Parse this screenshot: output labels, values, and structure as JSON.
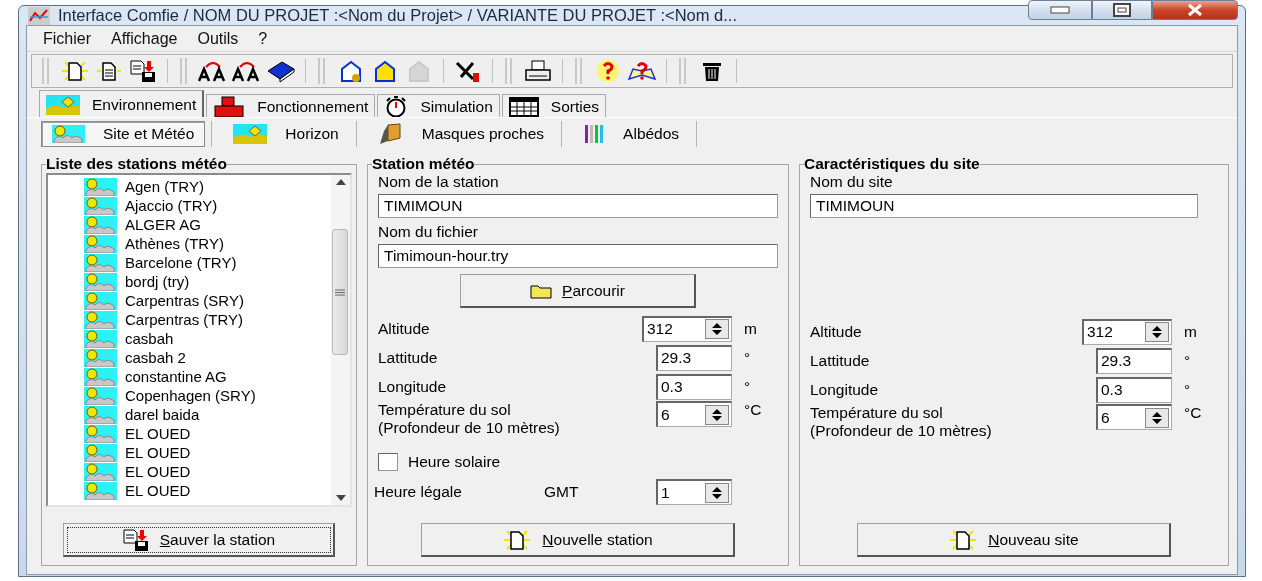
{
  "window": {
    "title": "Interface Comfie  /  NOM DU PROJET :<Nom du Projet>  /  VARIANTE DU PROJET :<Nom d..."
  },
  "menu": [
    "Fichier",
    "Affichage",
    "Outils",
    "?"
  ],
  "toolbar": [
    [
      {
        "disabled": false
      },
      {
        "disabled": false
      },
      {
        "disabled": false
      }
    ],
    [
      {
        "disabled": false
      },
      {
        "disabled": false
      },
      {
        "disabled": false
      }
    ],
    [
      {
        "disabled": false
      },
      {
        "disabled": false
      },
      {
        "disabled": true
      },
      {
        "disabled": false
      }
    ],
    [
      {
        "disabled": false
      }
    ],
    [
      {
        "disabled": false
      },
      {
        "disabled": false
      }
    ],
    [
      {
        "disabled": false
      }
    ]
  ],
  "tabs": [
    {
      "label": "Environnement",
      "selected": true
    },
    {
      "label": "Fonctionnement",
      "selected": false
    },
    {
      "label": "Simulation",
      "selected": false
    },
    {
      "label": "Sorties",
      "selected": false
    }
  ],
  "subtabs": [
    {
      "label": "Site et Météo",
      "selected": true
    },
    {
      "label": "Horizon",
      "selected": false
    },
    {
      "label": "Masques proches",
      "selected": false
    },
    {
      "label": "Albédos",
      "selected": false
    }
  ],
  "stations": {
    "title": "Liste des stations météo",
    "items": [
      "Agen (TRY)",
      "Ajaccio (TRY)",
      "ALGER AG",
      "Athènes (TRY)",
      "Barcelone (TRY)",
      "bordj (try)",
      "Carpentras (SRY)",
      "Carpentras (TRY)",
      "casbah",
      "casbah 2",
      "constantine AG",
      "Copenhagen (SRY)",
      "darel baida",
      "EL OUED",
      "EL OUED",
      "EL OUED",
      "EL OUED"
    ],
    "button": {
      "label": "Sauver la station",
      "mnemonic_underlined": true,
      "focused": true
    }
  },
  "station": {
    "title": "Station météo",
    "name_label": "Nom de la station",
    "name_value": "TIMIMOUN",
    "file_label": "Nom du fichier",
    "file_value": "Timimoun-hour.try",
    "browse": {
      "label": "Parcourir",
      "mnemonic_underlined": true
    },
    "rows": [
      {
        "kind": "wide-spin",
        "label": "Altitude",
        "value": "312",
        "unit": "m"
      },
      {
        "kind": "text",
        "label": "Lattitude",
        "value": "29.3",
        "unit": "°"
      },
      {
        "kind": "text",
        "label": "Longitude",
        "value": "0.3",
        "unit": "°"
      },
      {
        "kind": "spin",
        "label": "Température du sol",
        "sublabel": "(Profondeur de 10 mètres)",
        "value": "6",
        "unit": "°C"
      }
    ],
    "solar": {
      "label": "Heure solaire",
      "checked": false
    },
    "legal": {
      "label": "Heure légale",
      "gmt": "GMT",
      "value": "1"
    },
    "button": {
      "label": "Nouvelle station",
      "mnemonic_underlined": true
    }
  },
  "site": {
    "title": "Caractéristiques du site",
    "name_label": "Nom du site",
    "name_value": "TIMIMOUN",
    "rows": [
      {
        "kind": "wide-spin",
        "label": "Altitude",
        "value": "312",
        "unit": "m"
      },
      {
        "kind": "text",
        "label": "Lattitude",
        "value": "29.3",
        "unit": "°"
      },
      {
        "kind": "text",
        "label": "Longitude",
        "value": "0.3",
        "unit": "°"
      },
      {
        "kind": "spin",
        "label": "Température du sol",
        "sublabel": "(Profondeur de 10 mètres)",
        "value": "6",
        "unit": "°C"
      }
    ],
    "button": {
      "label": "Nouveau site",
      "mnemonic_underlined": true
    }
  }
}
